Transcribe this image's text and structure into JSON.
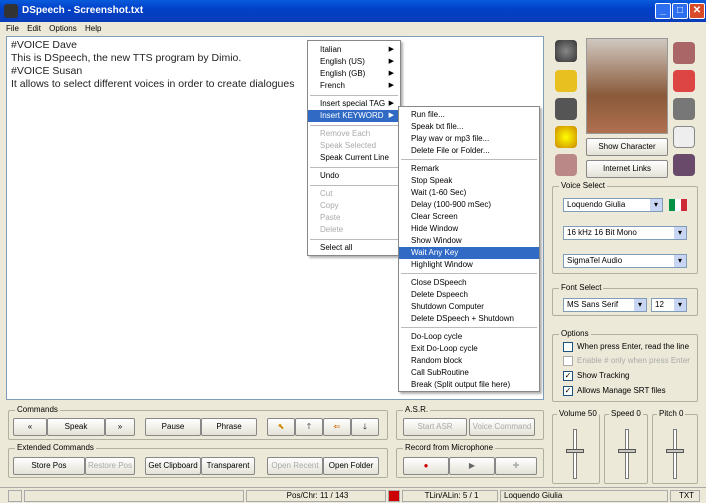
{
  "window": {
    "title": "DSpeech - Screenshot.txt"
  },
  "menubar": [
    "File",
    "Edit",
    "Options",
    "Help"
  ],
  "editor": {
    "lines": [
      "#VOICE Dave",
      "This is DSpeech, the new TTS program by Dimio.",
      "#VOICE Susan",
      "It allows to select different voices in order to create dialogues"
    ]
  },
  "context_menu": {
    "items": [
      {
        "label": "Italian",
        "arrow": true
      },
      {
        "label": "English (US)",
        "arrow": true
      },
      {
        "label": "English (GB)",
        "arrow": true
      },
      {
        "label": "French",
        "arrow": true
      },
      {
        "label": "Insert special TAG",
        "arrow": true
      },
      {
        "label": "Insert KEYWORD",
        "arrow": true
      },
      {
        "label": "Remove Each"
      },
      {
        "label": "Speak Selected"
      },
      {
        "label": "Speak Current Line"
      },
      {
        "label": "Undo"
      },
      {
        "label": "Cut"
      },
      {
        "label": "Copy"
      },
      {
        "label": "Paste"
      },
      {
        "label": "Delete"
      },
      {
        "label": "Select all"
      }
    ]
  },
  "keyword_menu": {
    "items": [
      "Run file...",
      "Speak txt file...",
      "Play wav or mp3 file...",
      "Delete File or Folder...",
      "Remark",
      "Stop Speak",
      "Wait (1-60 Sec)",
      "Delay (100-900 mSec)",
      "Clear Screen",
      "Hide Window",
      "Show Window",
      "Wait Any Key",
      "Highlight Window",
      "Close DSpeech",
      "Delete Dspeech",
      "Shutdown Computer",
      "Delete DSpeech + Shutdown",
      "Do-Loop cycle",
      "Exit Do-Loop cycle",
      "Random block",
      "Call SubRoutine",
      "Break (Split output file here)"
    ]
  },
  "commands": {
    "title": "Commands",
    "speak": "Speak",
    "prev": "«",
    "next": "»",
    "pause": "Pause",
    "phrase": "Phrase"
  },
  "extended": {
    "title": "Extended Commands",
    "store_pos": "Store Pos",
    "restore_pos": "Restore Pos",
    "get_clipboard": "Get Clipboard",
    "transparent": "Transparent",
    "open_recent": "Open Recent",
    "open_folder": "Open Folder"
  },
  "asr": {
    "title": "A.S.R.",
    "start": "Start ASR",
    "voice_command": "Voice Command"
  },
  "record": {
    "title": "Record from Microphone"
  },
  "character": {
    "show": "Show Character",
    "links": "Internet Links"
  },
  "voice_select": {
    "title": "Voice Select",
    "voice": "Loquendo Giulia",
    "format": "16 kHz 16 Bit Mono",
    "device": "SigmaTel Audio"
  },
  "font_select": {
    "title": "Font Select",
    "font": "MS Sans Serif",
    "size": "12"
  },
  "options": {
    "title": "Options",
    "items": [
      {
        "label": "When press Enter, read the line",
        "checked": false,
        "disabled": false
      },
      {
        "label": "Enable # only when press Enter",
        "checked": false,
        "disabled": true
      },
      {
        "label": "Show Tracking",
        "checked": true,
        "disabled": false
      },
      {
        "label": "Allows Manage SRT files",
        "checked": true,
        "disabled": false
      }
    ]
  },
  "sliders": {
    "volume": "Volume 50",
    "speed": "Speed 0",
    "pitch": "Pitch 0"
  },
  "status": {
    "pos": "Pos/Chr: 11 / 143",
    "tlin": "TLin/ALin: 5 / 1",
    "voice": "Loquendo Giulia",
    "mode": "TXT"
  }
}
